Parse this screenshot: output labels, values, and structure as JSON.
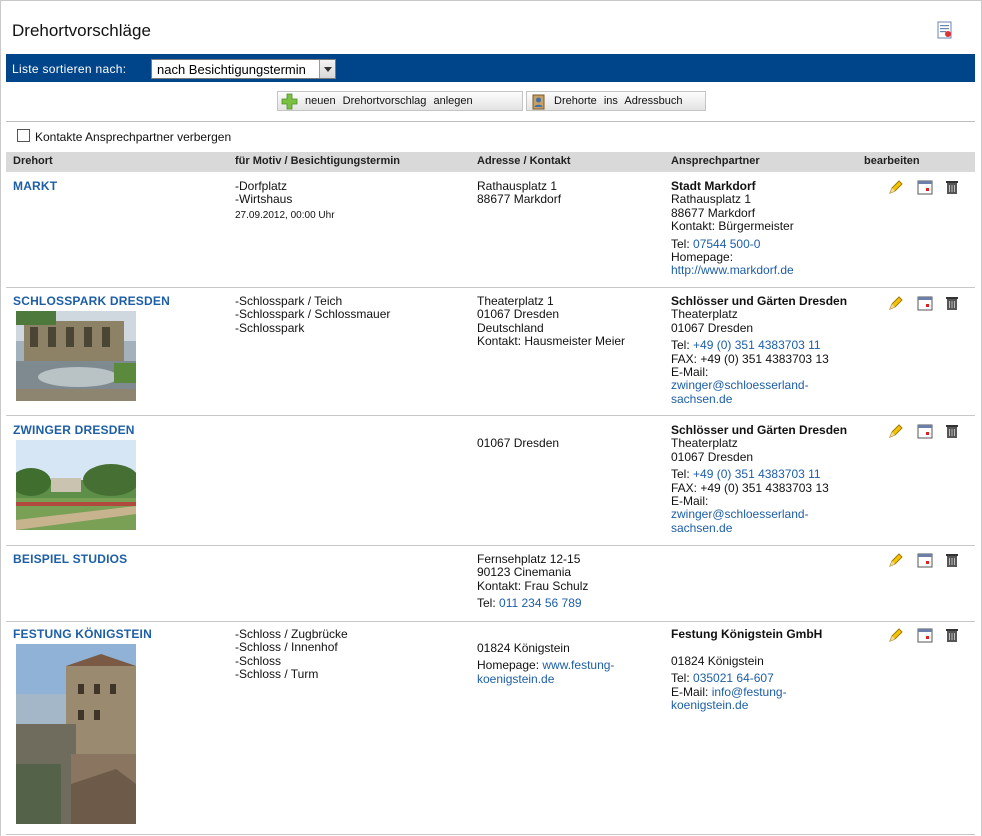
{
  "page": {
    "title": "Drehortvorschläge"
  },
  "sort": {
    "label": "Liste sortieren nach:",
    "selected": "nach Besichtigungstermin"
  },
  "toolbar": {
    "new_label": "neuen Drehortvorschlag anlegen",
    "addressbook_label": "Drehorte ins Adressbuch"
  },
  "filter": {
    "hide_contacts_label": "Kontakte Ansprechpartner verbergen",
    "checked": false
  },
  "table": {
    "headers": [
      "Drehort",
      "für Motiv / Besichtigungstermin",
      "Adresse / Kontakt",
      "Ansprechpartner",
      "bearbeiten"
    ],
    "rows": [
      {
        "name": "MARKT",
        "motif": [
          "-Dorfplatz",
          "-Wirtshaus"
        ],
        "date": "27.09.2012, 00:00 Uhr",
        "address": [
          "Rathausplatz 1",
          "88677 Markdorf"
        ],
        "address_tel_label": "",
        "address_tel": "",
        "address_home_label": "",
        "address_home": [
          "",
          ""
        ],
        "partner_name": "Stadt Markdorf",
        "partner_lines": [
          "Rathausplatz 1",
          "88677 Markdorf",
          "Kontakt: Bürgermeister"
        ],
        "partner_tel_label": "Tel:",
        "partner_tel": "07544 500-0",
        "partner_fax": "",
        "partner_extra_label": "Homepage:",
        "partner_extra": [
          "http://www.markdorf.de"
        ]
      },
      {
        "name": "SCHLOSSPARK DRESDEN",
        "motif": [
          "-Schlosspark / Teich",
          "-Schlosspark / Schlossmauer",
          "-Schlosspark"
        ],
        "date": "",
        "address": [
          "Theaterplatz 1",
          "01067 Dresden",
          "Deutschland",
          "Kontakt: Hausmeister Meier"
        ],
        "partner_name": "Schlösser und Gärten Dresden",
        "partner_lines": [
          "Theaterplatz",
          "01067 Dresden"
        ],
        "partner_tel_label": "Tel:",
        "partner_tel": "+49 (0) 351 4383703 11",
        "partner_fax": "FAX: +49 (0) 351 4383703 13",
        "partner_extra_label": "E-Mail:",
        "partner_extra": [
          "zwinger@schloesserland-",
          "sachsen.de"
        ]
      },
      {
        "name": "ZWINGER DRESDEN",
        "motif": [],
        "date": "",
        "address": [
          "01067 Dresden"
        ],
        "partner_name": "Schlösser und Gärten Dresden",
        "partner_lines": [
          "Theaterplatz",
          "01067 Dresden"
        ],
        "partner_tel_label": "Tel:",
        "partner_tel": "+49 (0) 351 4383703 11",
        "partner_fax": "FAX: +49 (0) 351 4383703 13",
        "partner_extra_label": "E-Mail:",
        "partner_extra": [
          "zwinger@schloesserland-",
          "sachsen.de"
        ]
      },
      {
        "name": "BEISPIEL STUDIOS",
        "motif": [],
        "date": "",
        "address": [
          "Fernsehplatz 12-15",
          "90123 Cinemania",
          "Kontakt: Frau Schulz"
        ],
        "address_tel_label": "Tel:",
        "address_tel": "011 234 56 789"
      },
      {
        "name": "FESTUNG KÖNIGSTEIN",
        "motif": [
          "-Schloss / Zugbrücke",
          "-Schloss / Innenhof",
          "-Schloss",
          "-Schloss / Turm"
        ],
        "date": "",
        "address": [
          "",
          "01824 Königstein"
        ],
        "address_home_label": "Homepage:",
        "address_home": [
          "www.festung-",
          "koenigstein.de"
        ],
        "partner_name": "Festung Königstein GmbH",
        "partner_lines": [
          "",
          "01824 Königstein"
        ],
        "partner_tel_label": "Tel:",
        "partner_tel": "035021 64-607",
        "partner_email_label": "E-Mail:",
        "partner_email": [
          "info@festung-",
          "koenigstein.de"
        ]
      }
    ]
  },
  "icons": {
    "print": "document-print-icon",
    "new": "plus-icon",
    "addressbook": "addressbook-icon",
    "edit": "pencil-icon",
    "calendar": "calendar-icon",
    "delete": "trash-icon"
  },
  "colors": {
    "sortbar": "#004489",
    "link": "#1d5ea6",
    "header_bg": "#d9d9d9"
  }
}
